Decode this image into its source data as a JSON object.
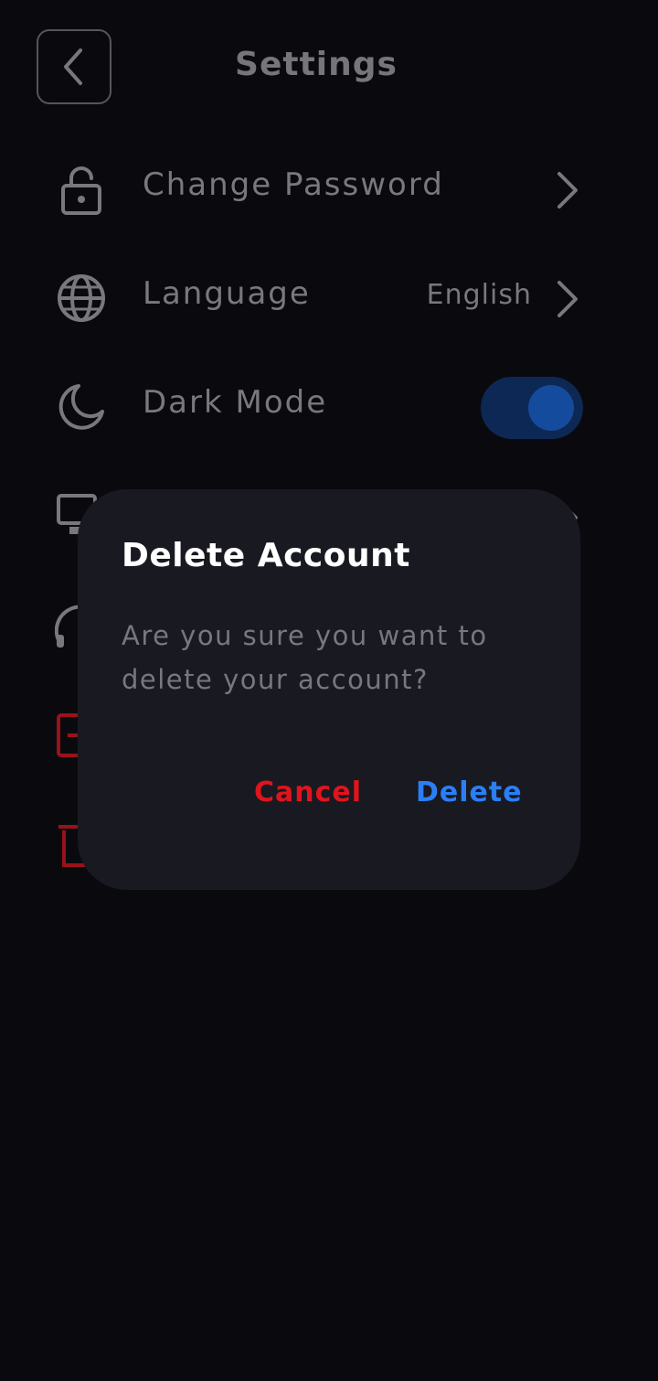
{
  "header": {
    "title": "Settings",
    "back_icon": "chevron-left-icon"
  },
  "settings": {
    "change_password": {
      "label": "Change Password",
      "icon": "lock-icon"
    },
    "language": {
      "label": "Language",
      "value": "English",
      "icon": "globe-icon"
    },
    "dark_mode": {
      "label": "Dark Mode",
      "icon": "moon-icon",
      "enabled": true
    },
    "hidden_items_icons": [
      "chat-icon",
      "support-icon",
      "logout-icon",
      "trash-icon"
    ]
  },
  "dialog": {
    "title": "Delete Account",
    "message": "Are you sure you want to delete your account?",
    "cancel_label": "Cancel",
    "delete_label": "Delete"
  },
  "colors": {
    "background": "#0a0a0e",
    "dialog": "#191921",
    "danger": "#e0141c",
    "accent": "#2b7ff5",
    "toggle_track": "#0d2855",
    "toggle_knob": "#154b9c"
  }
}
